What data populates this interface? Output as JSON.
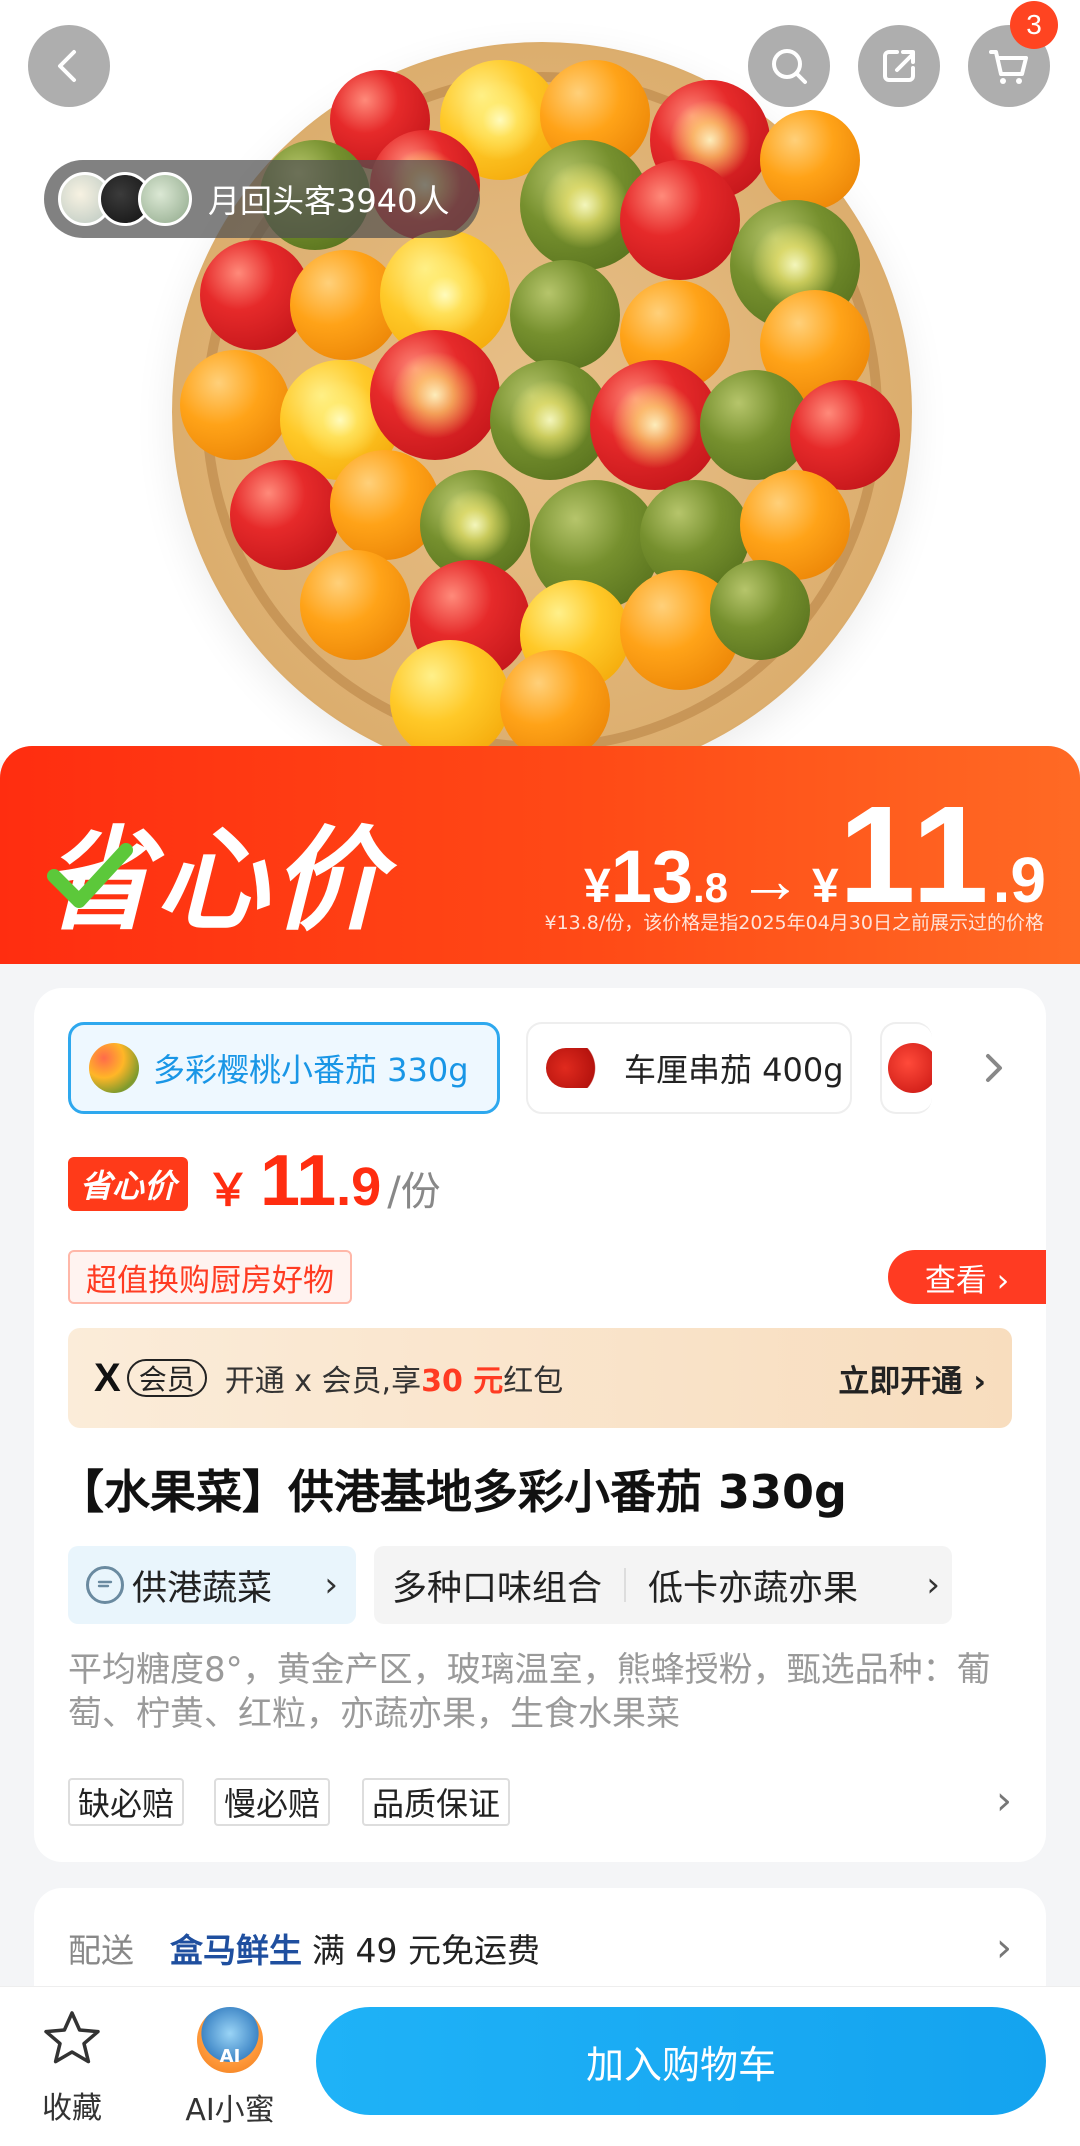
{
  "hero": {
    "repeat_customers": "月回头客3940人",
    "cart_count": "3"
  },
  "banner": {
    "label": "省心价",
    "yen": "¥",
    "orig_int": "13",
    "orig_dec": ".8",
    "arrow": "→",
    "now_int": "11",
    "now_dec": ".9",
    "note": "¥13.8/份，该价格是指2025年04月30日之前展示过的价格"
  },
  "sku_options": [
    {
      "label": "多彩樱桃小番茄 330g",
      "selected": true
    },
    {
      "label": "车厘串茄 400g",
      "selected": false
    },
    {
      "label": "",
      "selected": false
    }
  ],
  "price": {
    "badge": "省心价",
    "yen": "￥",
    "int": "11",
    "dec": ".9",
    "unit": "/份"
  },
  "promo": {
    "tag": "超值换购厨房好物",
    "view": "查看 ›"
  },
  "member": {
    "logo": "X",
    "chip": "会员",
    "text": "开通 x 会员,享 ",
    "amount": "30 元",
    "text2": "红包",
    "cta": "立即开通 ›"
  },
  "product_title": "【水果菜】供港基地多彩小番茄 330g",
  "features": {
    "primary": "供港蔬菜",
    "tags": [
      "多种口味组合",
      "低卡亦蔬亦果"
    ]
  },
  "description": "平均糖度8°，黄金产区，玻璃温室，熊蜂授粉，甄选品种：葡萄、柠黄、红粒，亦蔬亦果，生食水果菜",
  "guarantees": [
    "缺必赔",
    "慢必赔",
    "品质保证"
  ],
  "delivery": {
    "label": "配送",
    "brand": "盒马鲜生",
    "text": "满 49 元免运费"
  },
  "bottom": {
    "favorite": "收藏",
    "ai": "AI小蜜",
    "ai_badge": "AI",
    "add_cart": "加入购物车"
  },
  "colors": {
    "price_red": "#ff2d10",
    "accent_blue": "#14a3ef",
    "member_gold": "#f8ddbe"
  }
}
